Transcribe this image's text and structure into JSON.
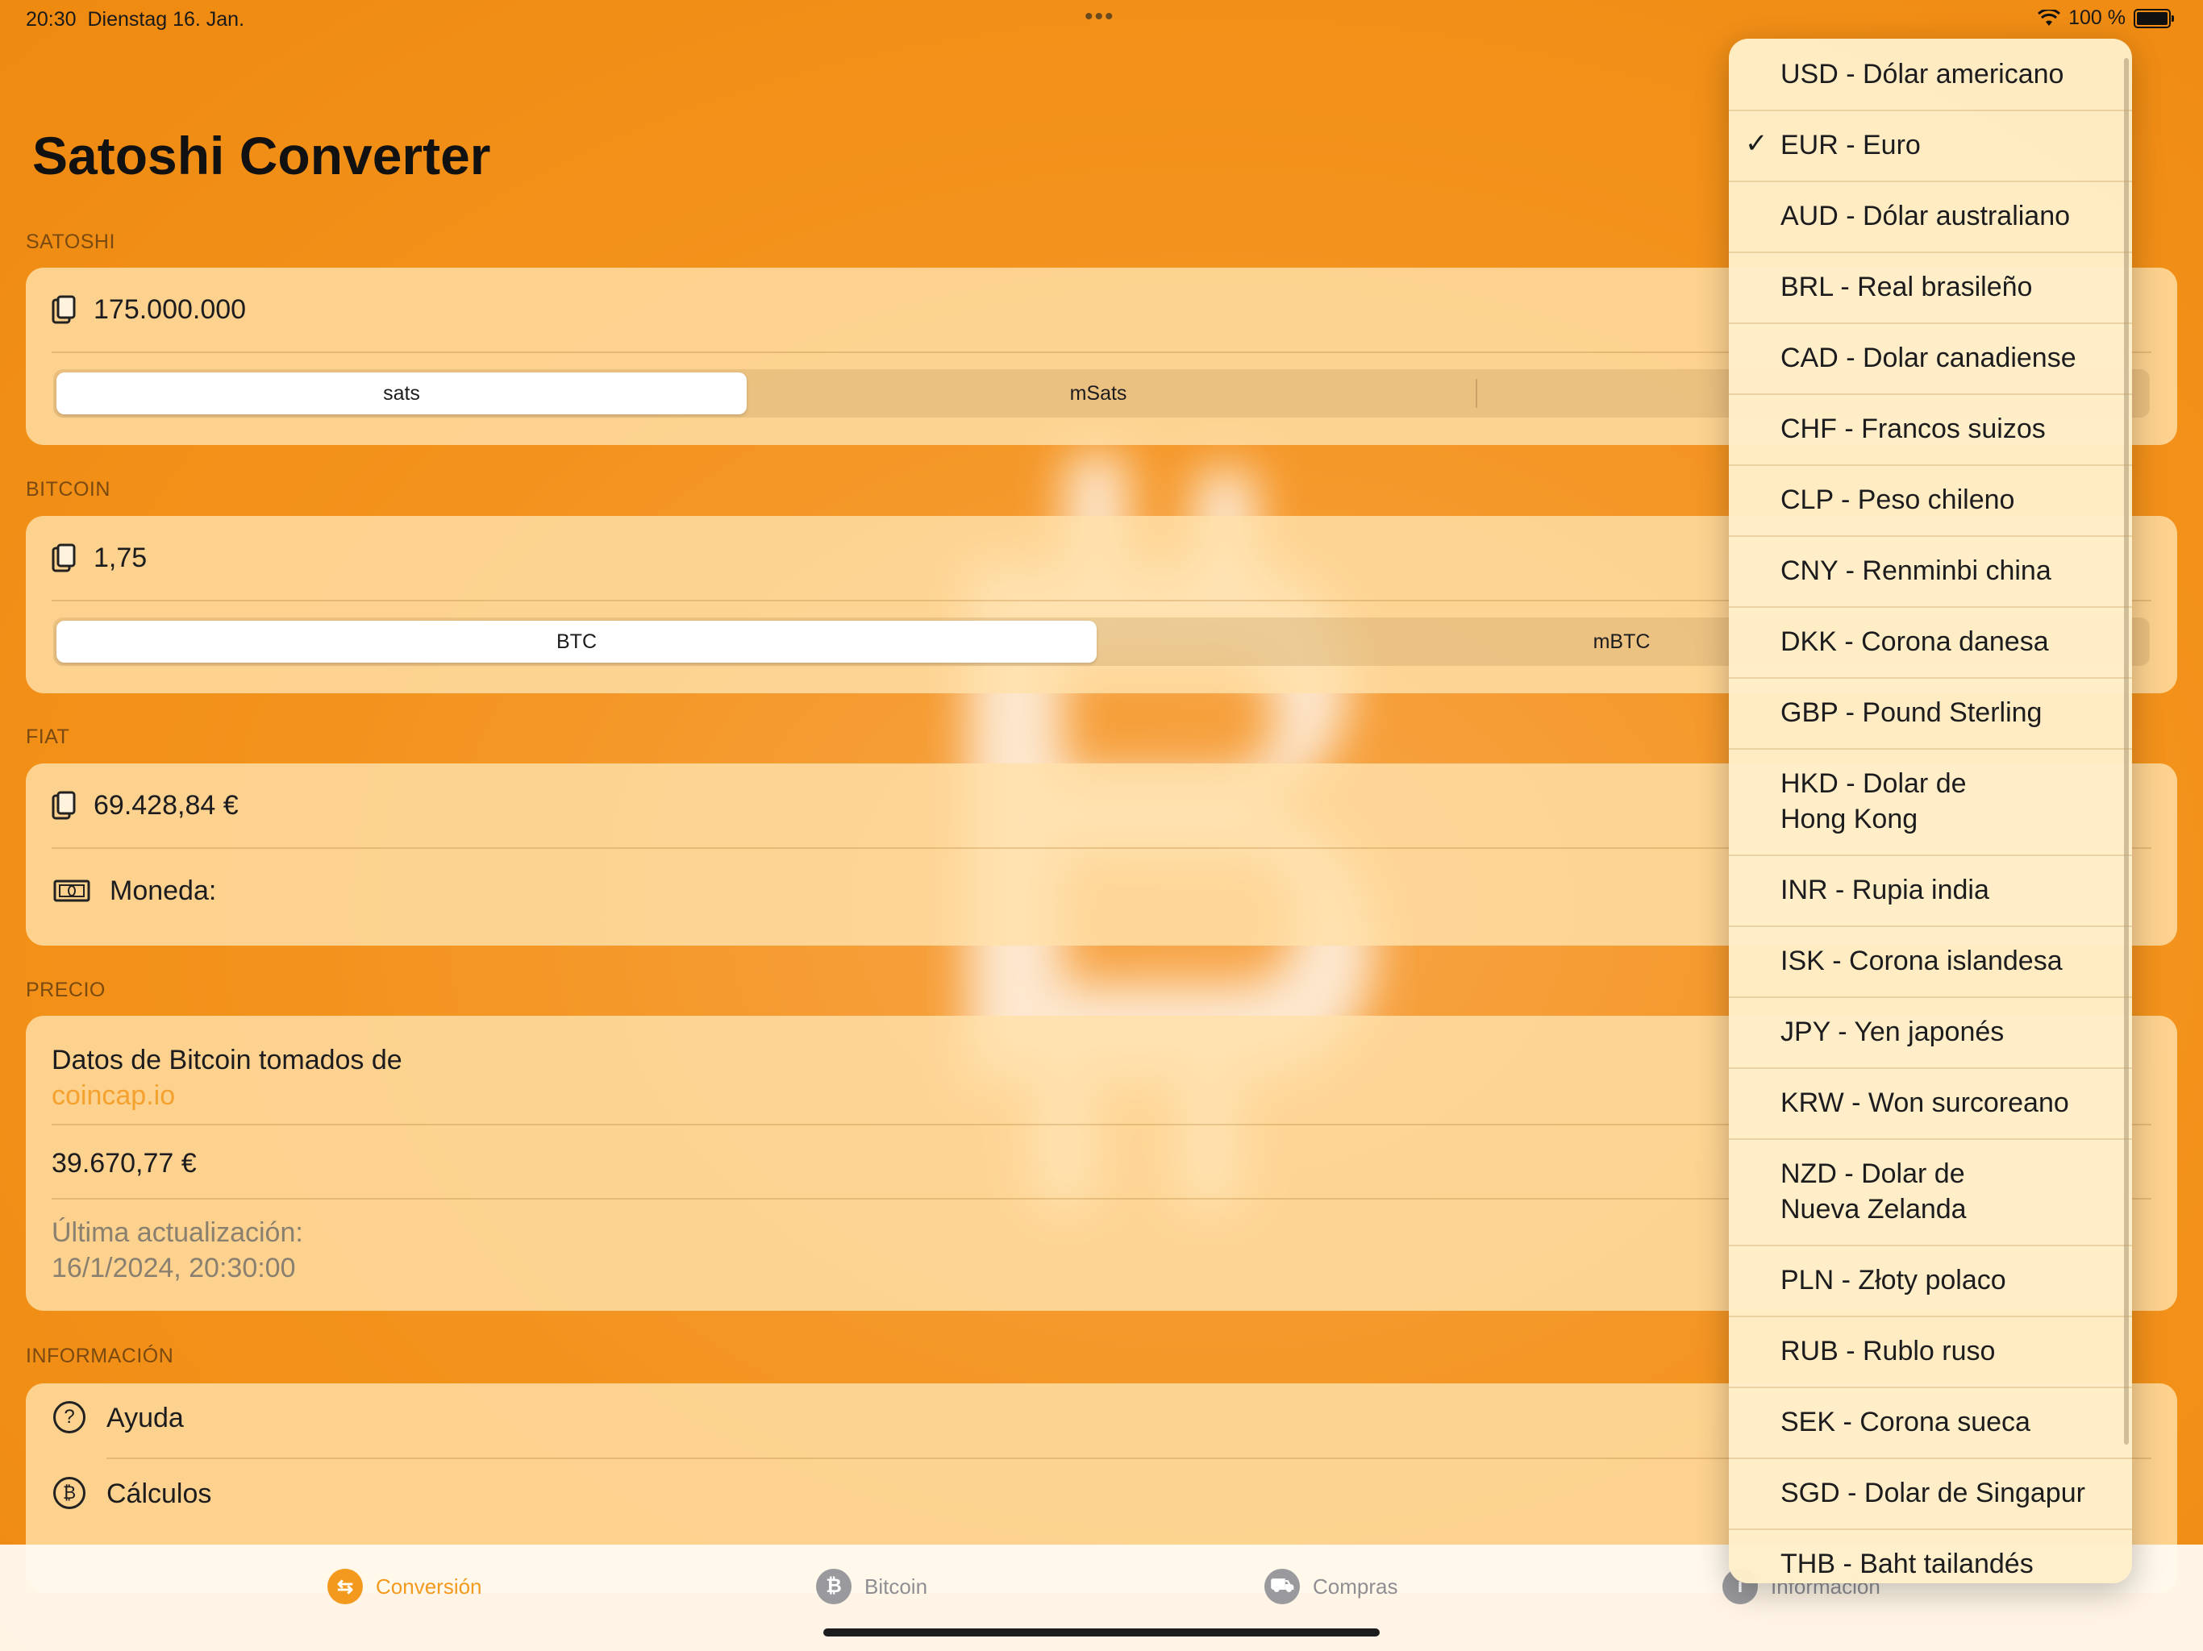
{
  "status_bar": {
    "time": "20:30",
    "date": "Dienstag 16. Jan.",
    "battery": "100 %"
  },
  "app": {
    "title": "Satoshi Converter"
  },
  "satoshi": {
    "section": "SATOSHI",
    "value": "175.000.000",
    "units": [
      "sats",
      "mSats"
    ],
    "selected_unit": "sats"
  },
  "bitcoin": {
    "section": "BITCOIN",
    "value": "1,75",
    "units": [
      "BTC",
      "mBTC"
    ],
    "selected_unit": "BTC"
  },
  "fiat": {
    "section": "FIAT",
    "value": "69.428,84 €",
    "currency_label": "Moneda:"
  },
  "price": {
    "section": "PRECIO",
    "source_text": "Datos de Bitcoin tomados de",
    "source_link": "coincap.io",
    "value": "39.670,77 €",
    "updated_label": "Última actualización:",
    "updated_value": "16/1/2024, 20:30:00"
  },
  "info": {
    "section": "INFORMACIÓN",
    "items": [
      {
        "label": "Ayuda",
        "icon": "question-circle-icon"
      },
      {
        "label": "Cálculos",
        "icon": "bitcoin-circle-icon"
      }
    ]
  },
  "tabs": [
    {
      "label": "Conversión",
      "icon": "swap-arrows-icon",
      "active": true
    },
    {
      "label": "Bitcoin",
      "icon": "bitcoin-icon",
      "active": false
    },
    {
      "label": "Compras",
      "icon": "cart-icon",
      "active": false
    },
    {
      "label": "Información",
      "icon": "info-icon",
      "active": false
    }
  ],
  "currency_menu": {
    "selected": "EUR - Euro",
    "items": [
      "USD - Dólar americano",
      "EUR - Euro",
      "AUD - Dólar australiano",
      "BRL - Real brasileño",
      "CAD - Dolar canadiense",
      "CHF - Francos suizos",
      "CLP - Peso chileno",
      "CNY - Renminbi china",
      "DKK - Corona danesa",
      "GBP - Pound Sterling",
      "HKD - Dolar de\nHong Kong",
      "INR - Rupia india",
      "ISK - Corona islandesa",
      "JPY - Yen japonés",
      "KRW - Won surcoreano",
      "NZD - Dolar de\nNueva Zelanda",
      "PLN - Złoty polaco",
      "RUB - Rublo ruso",
      "SEK - Corona sueca",
      "SGD - Dolar de Singapur",
      "THB - Baht tailandés"
    ]
  },
  "colors": {
    "accent": "#f39a1e",
    "background": "#f3921c",
    "card": "#ffe0aa"
  }
}
